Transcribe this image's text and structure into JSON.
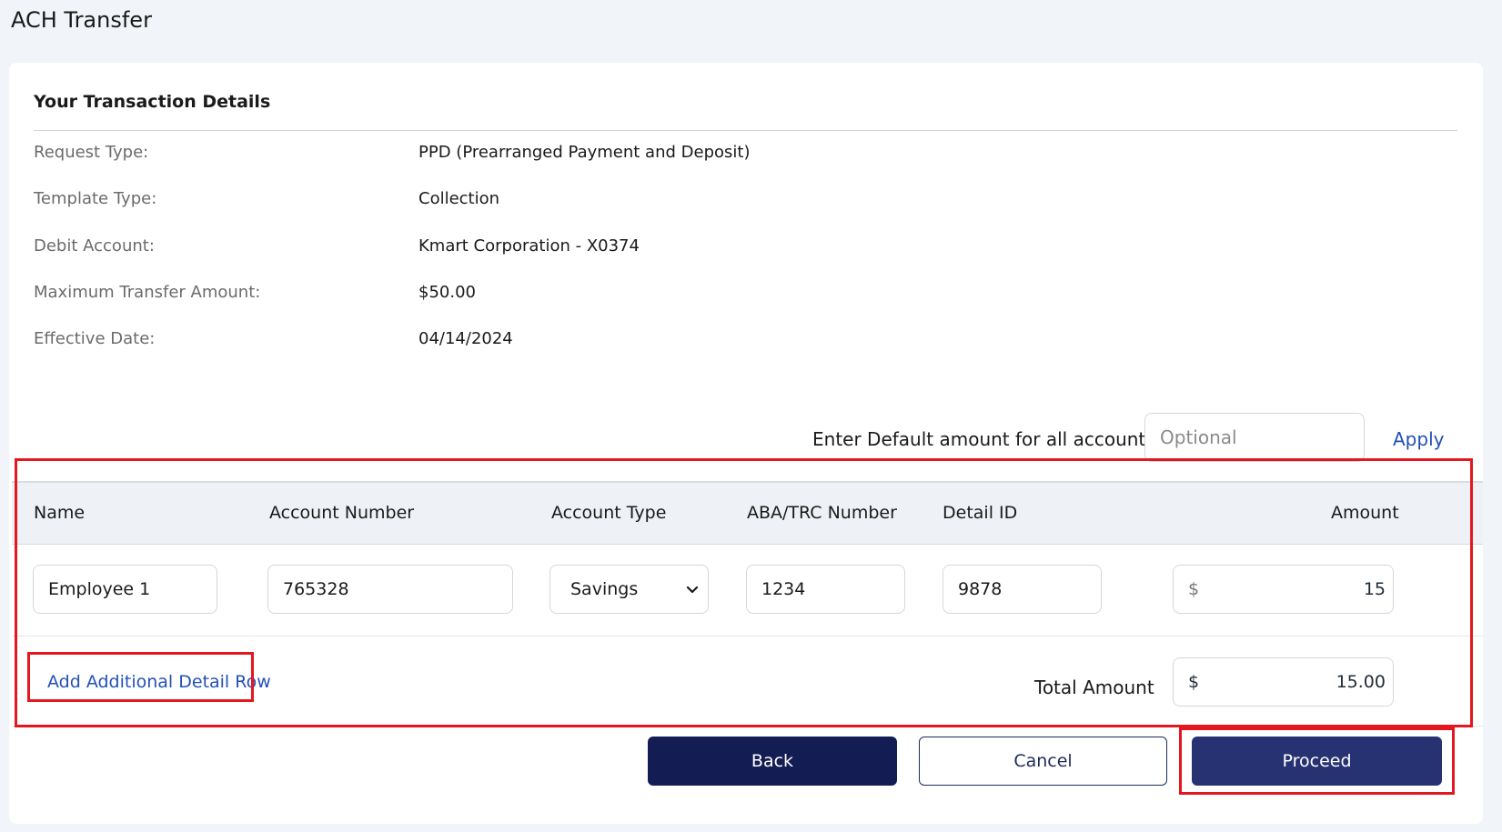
{
  "page": {
    "title": "ACH Transfer"
  },
  "details": {
    "section_title": "Your Transaction Details",
    "rows": [
      {
        "label": "Request Type:",
        "value": "PPD (Prearranged Payment and Deposit)"
      },
      {
        "label": "Template Type:",
        "value": "Collection"
      },
      {
        "label": "Debit Account:",
        "value": "Kmart Corporation - X0374"
      },
      {
        "label": "Maximum Transfer Amount:",
        "value": "$50.00"
      },
      {
        "label": "Effective Date:",
        "value": "04/14/2024"
      }
    ]
  },
  "default_amount": {
    "label": "Enter Default amount for all accounts $",
    "placeholder": "Optional",
    "value": "",
    "apply_label": "Apply"
  },
  "table": {
    "headers": {
      "name": "Name",
      "account_number": "Account Number",
      "account_type": "Account Type",
      "aba": "ABA/TRC Number",
      "detail_id": "Detail ID",
      "amount": "Amount"
    },
    "rows": [
      {
        "name": "Employee 1",
        "account_number": "765328",
        "account_type": "Savings",
        "aba": "1234",
        "detail_id": "9878",
        "amount_symbol": "$",
        "amount": "15"
      }
    ],
    "add_row_label": "Add Additional Detail Row",
    "total_label": "Total Amount",
    "total_symbol": "$",
    "total_value": "15.00"
  },
  "actions": {
    "back_label": "Back",
    "cancel_label": "Cancel",
    "proceed_label": "Proceed"
  },
  "colors": {
    "highlight": "#e3171d",
    "back_button": "#141c54",
    "proceed_button": "#273272",
    "link": "#2350b7"
  }
}
